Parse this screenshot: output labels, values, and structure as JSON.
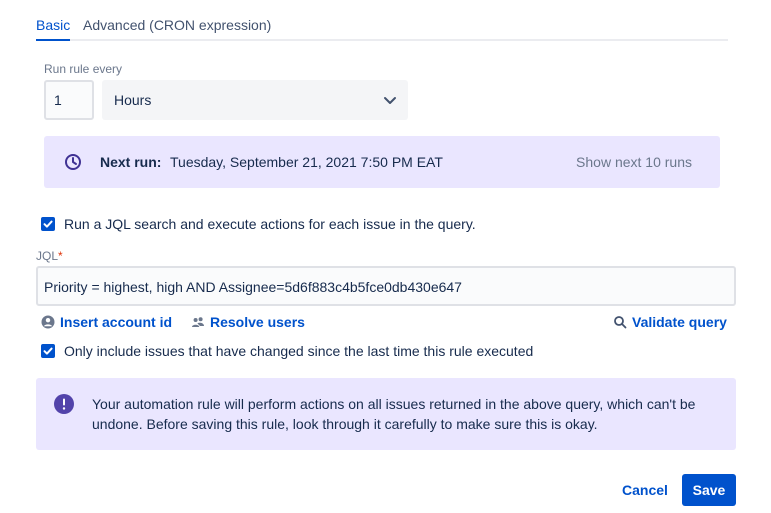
{
  "tabs": [
    {
      "label": "Basic",
      "active": true
    },
    {
      "label": "Advanced (CRON expression)",
      "active": false
    }
  ],
  "schedule": {
    "label": "Run rule every",
    "interval_value": "1",
    "unit": "Hours"
  },
  "next_run": {
    "label": "Next run:",
    "value": "Tuesday, September 21, 2021 7:50 PM EAT",
    "show_next": "Show next 10 runs"
  },
  "jql_checkbox": {
    "checked": true,
    "label": "Run a JQL search and execute actions for each issue in the query."
  },
  "jql": {
    "label": "JQL",
    "required_mark": "*",
    "value": "Priority = highest, high AND Assignee=5d6f883c4b5fce0db430e647"
  },
  "links": {
    "insert_account": "Insert account id",
    "resolve_users": "Resolve users",
    "validate_query": "Validate query"
  },
  "changed_checkbox": {
    "checked": true,
    "label": "Only include issues that have changed since the last time this rule executed"
  },
  "warning": {
    "message": "Your automation rule will perform actions on all issues returned in the above query, which can't be undone. Before saving this rule, look through it carefully to make sure this is okay."
  },
  "footer": {
    "cancel": "Cancel",
    "save": "Save"
  },
  "colors": {
    "primary": "#0052cc",
    "panel": "#eae6ff",
    "accent_purple": "#5243aa"
  }
}
